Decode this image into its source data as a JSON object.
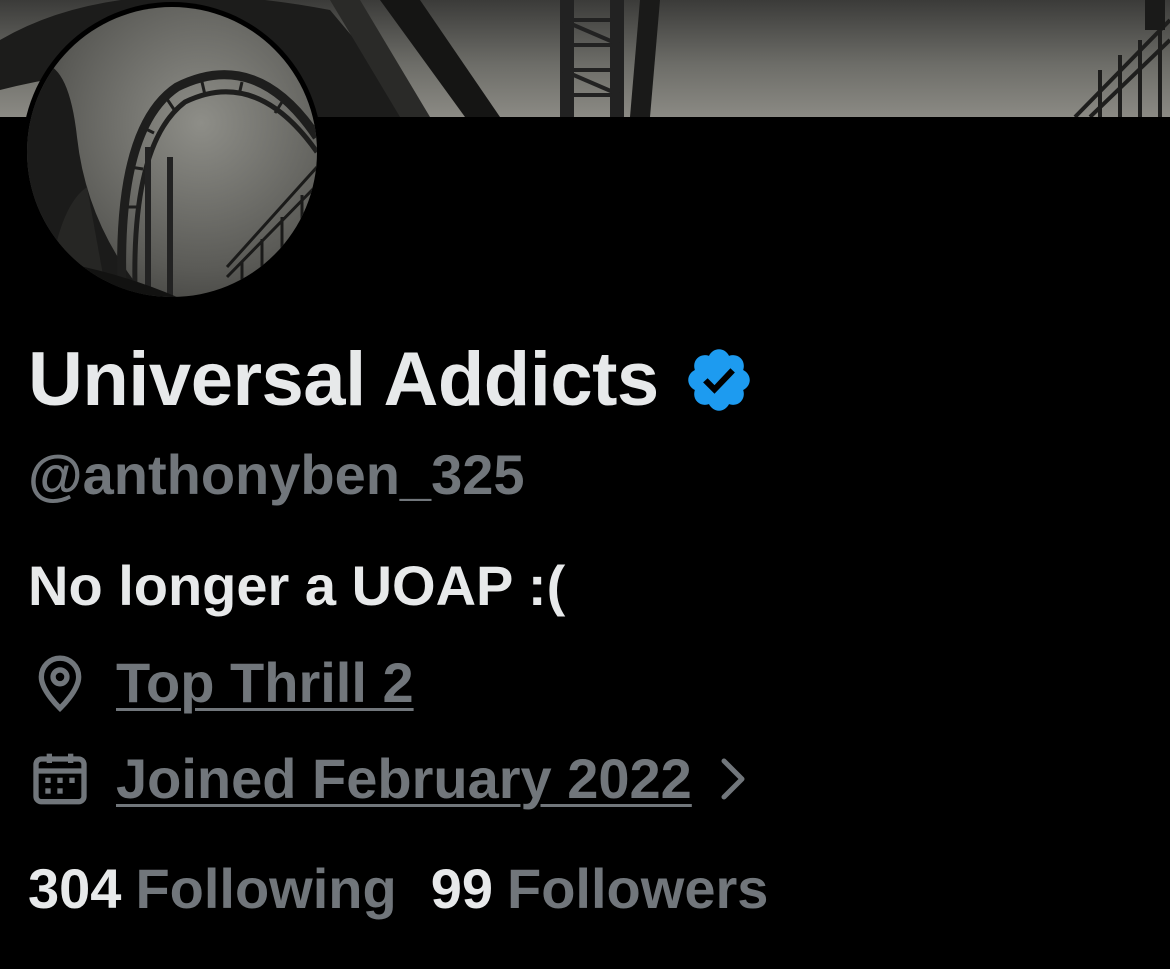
{
  "profile": {
    "display_name": "Universal Addicts",
    "handle": "@anthonyben_325",
    "bio": "No longer a UOAP :(",
    "verified": true,
    "location": "Top Thrill 2",
    "joined": "Joined February 2022"
  },
  "stats": {
    "following_count": "304",
    "following_label": "Following",
    "followers_count": "99",
    "followers_label": "Followers"
  },
  "icons": {
    "verified": "verified-badge-icon",
    "location": "location-pin-icon",
    "joined": "calendar-icon",
    "chevron": "chevron-right-icon"
  },
  "colors": {
    "background": "#000000",
    "text_primary": "#e7e9ea",
    "text_secondary": "#71767b",
    "verified_blue": "#1d9bf0"
  }
}
